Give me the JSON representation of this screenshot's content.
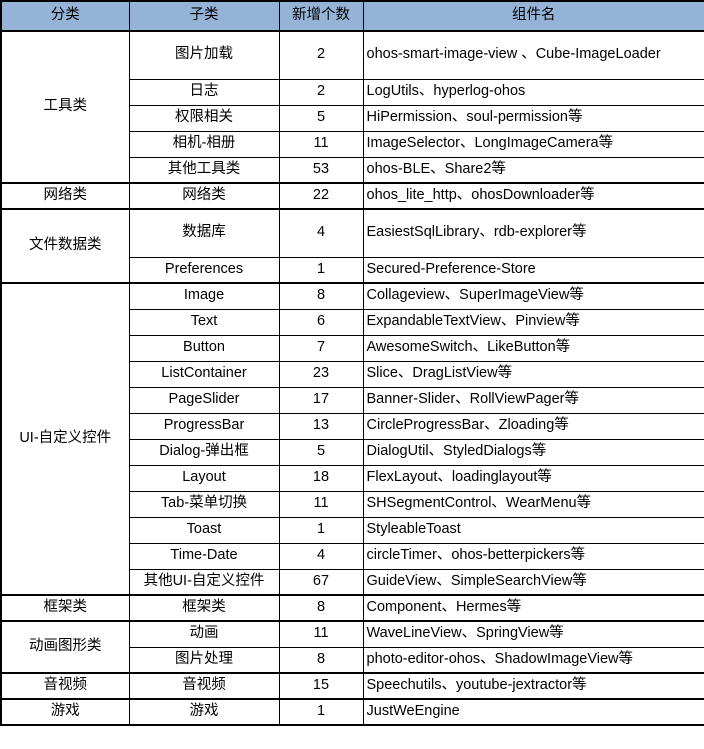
{
  "table": {
    "headers": [
      "分类",
      "子类",
      "新增个数",
      "组件名"
    ],
    "rows": [
      {
        "category": "工具类",
        "catspan": 5,
        "group_start": true,
        "sub": "图片加载",
        "count": "2",
        "components": "ohos-smart-image-view 、Cube-ImageLoader",
        "tall": true
      },
      {
        "sub": "日志",
        "count": "2",
        "components": "LogUtils、hyperlog-ohos"
      },
      {
        "sub": "权限相关",
        "count": "5",
        "components": "HiPermission、soul-permission等"
      },
      {
        "sub": "相机-相册",
        "count": "11",
        "components": "ImageSelector、LongImageCamera等"
      },
      {
        "sub": "其他工具类",
        "count": "53",
        "components": "ohos-BLE、Share2等"
      },
      {
        "category": "网络类",
        "catspan": 1,
        "group_start": true,
        "sub": "网络类",
        "count": "22",
        "components": "ohos_lite_http、ohosDownloader等"
      },
      {
        "category": "文件数据类",
        "catspan": 2,
        "group_start": true,
        "sub": "数据库",
        "count": "4",
        "components": "EasiestSqlLibrary、rdb-explorer等",
        "tall": true
      },
      {
        "sub": "Preferences",
        "count": "1",
        "components": "Secured-Preference-Store"
      },
      {
        "category": "UI-自定义控件",
        "catspan": 12,
        "group_start": true,
        "sub": "Image",
        "count": "8",
        "components": "Collageview、SuperImageView等"
      },
      {
        "sub": "Text",
        "count": "6",
        "components": "ExpandableTextView、Pinview等"
      },
      {
        "sub": "Button",
        "count": "7",
        "components": "AwesomeSwitch、LikeButton等"
      },
      {
        "sub": "ListContainer",
        "count": "23",
        "components": "Slice、DragListView等"
      },
      {
        "sub": "PageSlider",
        "count": "17",
        "components": "Banner-Slider、RollViewPager等"
      },
      {
        "sub": "ProgressBar",
        "count": "13",
        "components": "CircleProgressBar、Zloading等"
      },
      {
        "sub": "Dialog-弹出框",
        "count": "5",
        "components": "DialogUtil、StyledDialogs等"
      },
      {
        "sub": "Layout",
        "count": "18",
        "components": "FlexLayout、loadinglayout等"
      },
      {
        "sub": "Tab-菜单切换",
        "count": "11",
        "components": "SHSegmentControl、WearMenu等"
      },
      {
        "sub": "Toast",
        "count": "1",
        "components": "StyleableToast"
      },
      {
        "sub": "Time-Date",
        "count": "4",
        "components": "circleTimer、ohos-betterpickers等"
      },
      {
        "sub": "其他UI-自定义控件",
        "count": "67",
        "components": "GuideView、SimpleSearchView等"
      },
      {
        "category": "框架类",
        "catspan": 1,
        "group_start": true,
        "sub": "框架类",
        "count": "8",
        "components": "Component、Hermes等"
      },
      {
        "category": "动画图形类",
        "catspan": 2,
        "group_start": true,
        "sub": "动画",
        "count": "11",
        "components": "WaveLineView、SpringView等"
      },
      {
        "sub": "图片处理",
        "count": "8",
        "components": "photo-editor-ohos、ShadowImageView等"
      },
      {
        "category": "音视频",
        "catspan": 1,
        "group_start": true,
        "sub": "音视频",
        "count": "15",
        "components": "Speechutils、youtube-jextractor等"
      },
      {
        "category": "游戏",
        "catspan": 1,
        "group_start": true,
        "last": true,
        "sub": "游戏",
        "count": "1",
        "components": "JustWeEngine"
      }
    ]
  },
  "colors": {
    "header_background": "#95b3d7",
    "border": "#000000",
    "text": "#000000",
    "page_background": "#ffffff"
  }
}
